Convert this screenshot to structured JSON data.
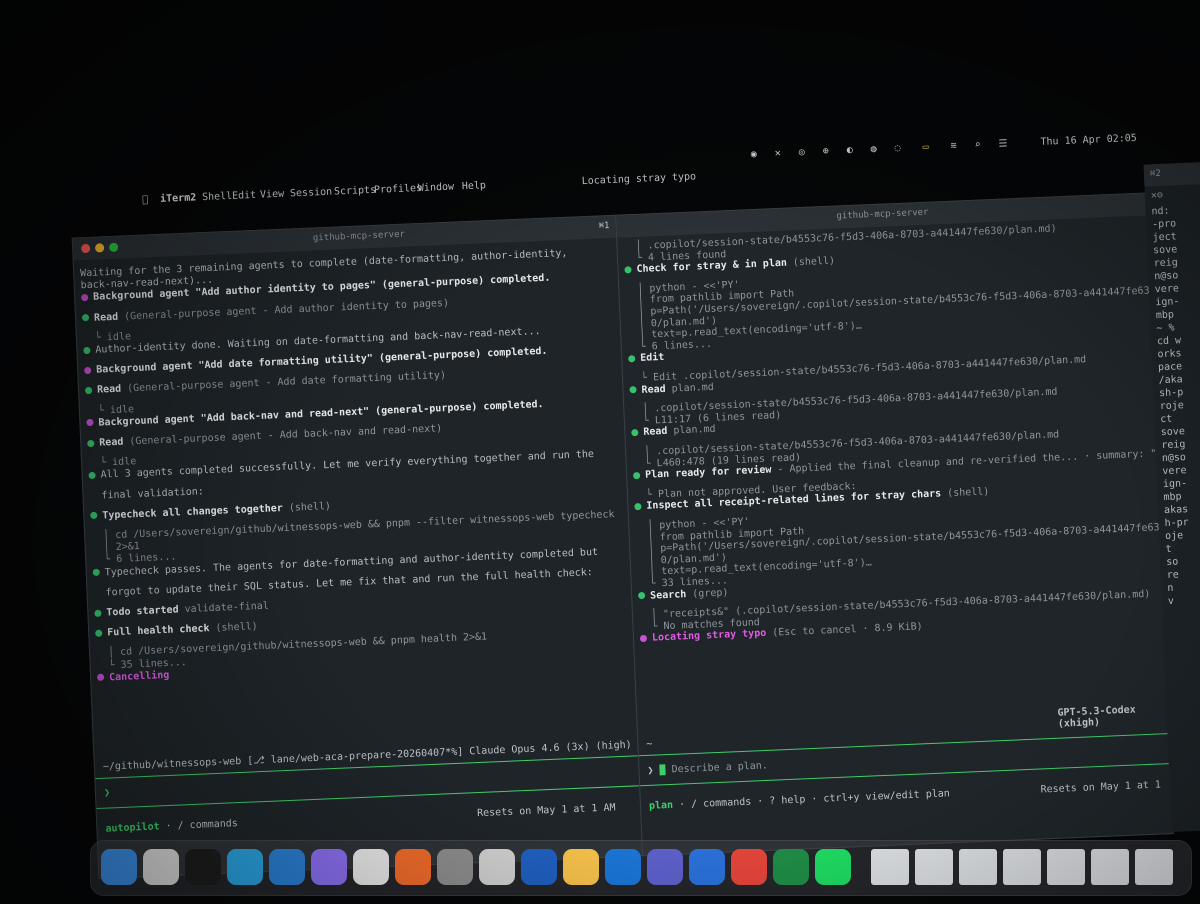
{
  "menubar": {
    "items": [
      "iTerm2",
      "Shell",
      "Edit",
      "View",
      "Session",
      "Scripts",
      "Profiles",
      "Window",
      "Help"
    ],
    "window_title": "Locating stray typo",
    "clock": "Thu 16 Apr 02:05",
    "tab_shortcut": "⌘1",
    "tab_indicator": "⌘2"
  },
  "left_pane": {
    "title": "github-mcp-server",
    "lines": [
      {
        "kind": "text",
        "text": "Waiting for the 3 remaining agents to complete (date-formatting, author-identity,"
      },
      {
        "kind": "text",
        "text": "back-nav-read-next)..."
      },
      {
        "kind": "bullet",
        "color": "purple",
        "bold": "Background agent \"Add author identity to pages\" (general-purpose) completed."
      },
      {
        "kind": "bullet",
        "color": "green",
        "bold": "Read",
        "rest": " (General-purpose agent - Add author identity to pages)"
      },
      {
        "kind": "sub",
        "text": "└ idle"
      },
      {
        "kind": "bullet",
        "color": "green",
        "text": "Author-identity done. Waiting on date-formatting and back-nav-read-next..."
      },
      {
        "kind": "bullet",
        "color": "purple",
        "bold": "Background agent \"Add date formatting utility\" (general-purpose) completed."
      },
      {
        "kind": "bullet",
        "color": "green",
        "bold": "Read",
        "rest": " (General-purpose agent - Add date formatting utility)"
      },
      {
        "kind": "sub",
        "text": "└ idle"
      },
      {
        "kind": "bullet",
        "color": "purple",
        "bold": "Background agent \"Add back-nav and read-next\" (general-purpose) completed."
      },
      {
        "kind": "bullet",
        "color": "green",
        "bold": "Read",
        "rest": " (General-purpose agent - Add back-nav and read-next)"
      },
      {
        "kind": "sub",
        "text": "└ idle"
      },
      {
        "kind": "bullet",
        "color": "green",
        "text": "All 3 agents completed successfully. Let me verify everything together and run the"
      },
      {
        "kind": "text2",
        "text": "final validation:"
      },
      {
        "kind": "bullet",
        "color": "green",
        "bold": "Typecheck all changes together",
        "rest": " (shell)"
      },
      {
        "kind": "sub",
        "text": "│ cd /Users/sovereign/github/witnessops-web && pnpm --filter witnessops-web typecheck"
      },
      {
        "kind": "sub",
        "text": "│ 2>&1"
      },
      {
        "kind": "sub",
        "text": "└ 6 lines..."
      },
      {
        "kind": "bullet",
        "color": "green",
        "text": "Typecheck passes. The agents for date-formatting and author-identity completed but"
      },
      {
        "kind": "text2",
        "text": "forgot to update their SQL status. Let me fix that and run the full health check:"
      },
      {
        "kind": "bullet",
        "color": "green",
        "bold": "Todo started",
        "rest": " validate-final"
      },
      {
        "kind": "bullet",
        "color": "green",
        "bold": "Full health check",
        "rest": " (shell)"
      },
      {
        "kind": "sub",
        "text": "│ cd /Users/sovereign/github/witnessops-web && pnpm health 2>&1"
      },
      {
        "kind": "sub",
        "text": "└ 35 lines..."
      },
      {
        "kind": "cancel",
        "text": "Cancelling"
      }
    ],
    "status_line": "~/github/witnessops-web [⎇ lane/web-aca-prepare-20260407*%]  Claude Opus 4.6 (3x) (high)",
    "prompt": "❯",
    "footer_left": "autopilot",
    "footer_mid": " · / commands",
    "footer_right": "Resets on May 1 at 1 AM"
  },
  "right_pane": {
    "title": "github-mcp-server",
    "lines": [
      {
        "kind": "sub",
        "text": "│ .copilot/session-state/b4553c76-f5d3-406a-8703-a441447fe630/plan.md)"
      },
      {
        "kind": "sub",
        "text": "└ 4 lines found"
      },
      {
        "kind": "bullet",
        "color": "green",
        "bold": "Check for stray & in plan",
        "rest": " (shell)"
      },
      {
        "kind": "sub",
        "text": "│ python - <<'PY'"
      },
      {
        "kind": "sub",
        "text": "│ from pathlib import Path"
      },
      {
        "kind": "sub",
        "text": "│ p=Path('/Users/sovereign/.copilot/session-state/b4553c76-f5d3-406a-8703-a441447fe63"
      },
      {
        "kind": "sub",
        "text": "│ 0/plan.md')"
      },
      {
        "kind": "sub",
        "text": "│ text=p.read_text(encoding='utf-8')…"
      },
      {
        "kind": "sub",
        "text": "└ 6 lines..."
      },
      {
        "kind": "bullet",
        "color": "green",
        "bold": "Edit"
      },
      {
        "kind": "sub",
        "text": "└ Edit .copilot/session-state/b4553c76-f5d3-406a-8703-a441447fe630/plan.md"
      },
      {
        "kind": "bullet",
        "color": "green",
        "bold": "Read",
        "rest": " plan.md"
      },
      {
        "kind": "sub",
        "text": "│ .copilot/session-state/b4553c76-f5d3-406a-8703-a441447fe630/plan.md"
      },
      {
        "kind": "sub",
        "text": "└ L11:17 (6 lines read)"
      },
      {
        "kind": "bullet",
        "color": "green",
        "bold": "Read",
        "rest": " plan.md"
      },
      {
        "kind": "sub",
        "text": "│ .copilot/session-state/b4553c76-f5d3-406a-8703-a441447fe630/plan.md"
      },
      {
        "kind": "sub",
        "text": "└ L460:478 (19 lines read)"
      },
      {
        "kind": "bullet",
        "color": "green",
        "bold": "Plan ready for review",
        "rest": " - Applied the final cleanup and re-verified the... · summary: \"-…"
      },
      {
        "kind": "sub",
        "text": "└ Plan not approved. User feedback:"
      },
      {
        "kind": "bullet",
        "color": "green",
        "bold": "Inspect all receipt-related lines for stray chars",
        "rest": " (shell)"
      },
      {
        "kind": "sub",
        "text": "│ python - <<'PY'"
      },
      {
        "kind": "sub",
        "text": "│ from pathlib import Path"
      },
      {
        "kind": "sub",
        "text": "│ p=Path('/Users/sovereign/.copilot/session-state/b4553c76-f5d3-406a-8703-a441447fe63"
      },
      {
        "kind": "sub",
        "text": "│ 0/plan.md')"
      },
      {
        "kind": "sub",
        "text": "│ text=p.read_text(encoding='utf-8')…"
      },
      {
        "kind": "sub",
        "text": "└ 33 lines..."
      },
      {
        "kind": "bullet",
        "color": "green",
        "bold": "Search",
        "rest": " (grep)"
      },
      {
        "kind": "sub",
        "text": "│ \"receipts&\" (.copilot/session-state/b4553c76-f5d3-406a-8703-a441447fe630/plan.md)"
      },
      {
        "kind": "sub",
        "text": "└ No matches found"
      },
      {
        "kind": "locating",
        "bold": "Locating stray typo",
        "rest": " (Esc to cancel · 8.9 KiB)"
      }
    ],
    "model": "GPT-5.3-Codex (xhigh)",
    "tilde": "~",
    "prompt": "❯",
    "placeholder": "Describe a plan.",
    "footer_left": "plan",
    "footer_mid": " · / commands · ? help · ctrl+y view/edit plan",
    "footer_right": "Resets on May 1 at 1"
  },
  "far_right": {
    "lines": [
      "nd:",
      "-pro",
      "ject",
      "sove",
      "reig",
      "n@so",
      "vere",
      "ign-",
      "mbp",
      "~ %",
      "cd w",
      "orks",
      "pace",
      "/aka",
      "sh-p",
      "roje",
      "ct",
      "sove",
      "reig",
      "n@so",
      "vere",
      "ign-",
      "mbp",
      "akas",
      "h-pr",
      "oje",
      "t",
      "so",
      "re",
      "n",
      "v"
    ]
  },
  "dock": {
    "icons": [
      "finder-icon",
      "launchpad-icon",
      "terminal-icon",
      "telegram-icon",
      "vscode-icon",
      "messenger-icon",
      "chatgpt-icon",
      "firefox-icon",
      "settings-icon",
      "screenshot-icon",
      "bitwarden-icon",
      "figma-icon",
      "outlook-icon",
      "teams-icon",
      "calendar-icon",
      "acrobat-icon",
      "excel-icon",
      "spotify-icon"
    ]
  }
}
